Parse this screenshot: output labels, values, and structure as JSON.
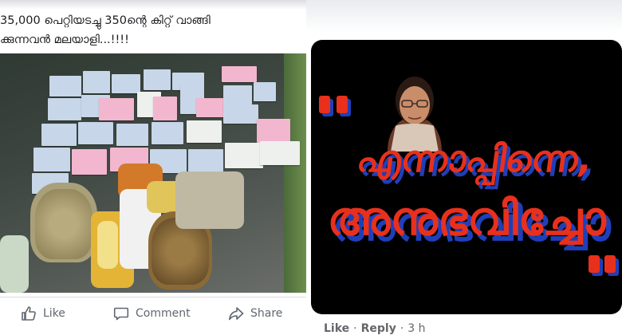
{
  "post": {
    "caption_line1": "35,000 പെറ്റിയടച്ചു 350ന്റെ കിറ്റ് വാങ്ങി",
    "caption_line2": "ക്കുന്നവൻ മലയാളി...!!!!",
    "actions": {
      "like": "Like",
      "comment": "Comment",
      "share": "Share"
    }
  },
  "comment": {
    "meme_line1": "എന്നാപ്പിന്നെ,",
    "meme_line2": "അനുഭവിച്ചോ",
    "like_label": "Like",
    "reply_label": "Reply",
    "time": "3 h"
  },
  "colors": {
    "meme_text": "#e8301c",
    "meme_shadow": "#1f3fb8",
    "meme_bg": "#000000",
    "action_gray": "#606770"
  }
}
